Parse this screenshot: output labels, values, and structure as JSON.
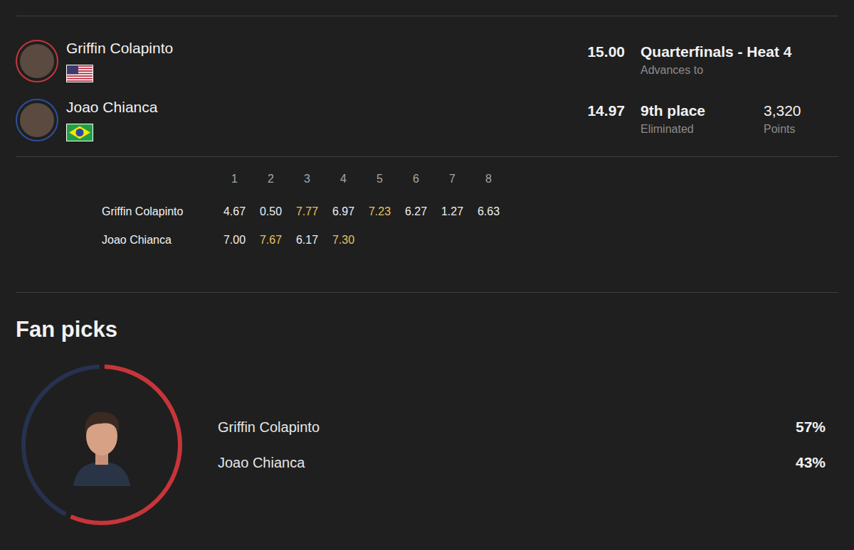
{
  "athletes": [
    {
      "name": "Griffin Colapinto",
      "flag": "usa",
      "color": "#c7353a",
      "score": "15.00",
      "result": "Quarterfinals - Heat 4",
      "result_label": "Advances to"
    },
    {
      "name": "Joao Chianca",
      "flag": "brazil",
      "color": "#2d4f9e",
      "score": "14.97",
      "result": "9th place",
      "result_label": "Eliminated",
      "points": "3,320",
      "points_label": "Points"
    }
  ],
  "waves": {
    "columns": [
      "1",
      "2",
      "3",
      "4",
      "5",
      "6",
      "7",
      "8"
    ],
    "rows": [
      {
        "name": "Griffin Colapinto",
        "scores": [
          {
            "value": "4.67",
            "counted": false
          },
          {
            "value": "0.50",
            "counted": false
          },
          {
            "value": "7.77",
            "counted": true
          },
          {
            "value": "6.97",
            "counted": false
          },
          {
            "value": "7.23",
            "counted": true
          },
          {
            "value": "6.27",
            "counted": false
          },
          {
            "value": "1.27",
            "counted": false
          },
          {
            "value": "6.63",
            "counted": false
          }
        ]
      },
      {
        "name": "Joao Chianca",
        "scores": [
          {
            "value": "7.00",
            "counted": false
          },
          {
            "value": "7.67",
            "counted": true
          },
          {
            "value": "6.17",
            "counted": false
          },
          {
            "value": "7.30",
            "counted": true
          }
        ]
      }
    ]
  },
  "fan_picks": {
    "title": "Fan picks",
    "items": [
      {
        "name": "Griffin Colapinto",
        "reading": "57%",
        "level": 0.57,
        "color": "#c7353a",
        "selected": true
      },
      {
        "name": "Joao Chianca",
        "reading": "43%",
        "level": 0.43,
        "color": "#26324f",
        "selected": false
      }
    ]
  }
}
